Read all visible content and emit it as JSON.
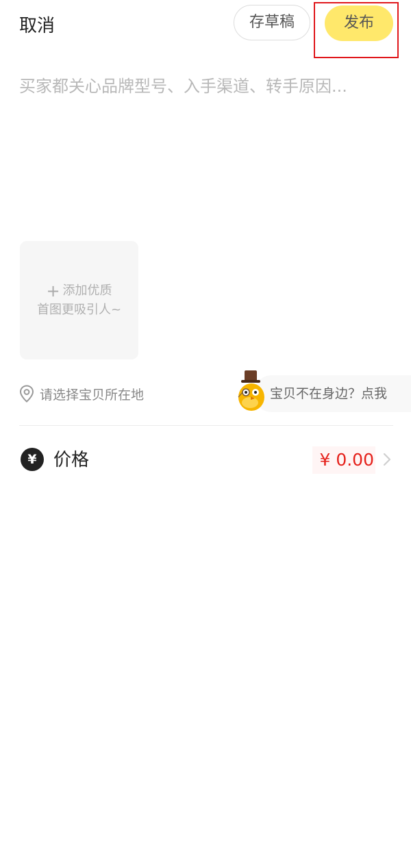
{
  "header": {
    "cancel_label": "取消",
    "draft_label": "存草稿",
    "publish_label": "发布"
  },
  "description": {
    "placeholder": "买家都关心品牌型号、入手渠道、转手原因..."
  },
  "photo": {
    "add_line1": "添加优质",
    "add_line2": "首图更吸引人~",
    "icon": "plus-icon"
  },
  "location": {
    "icon": "location-pin-icon",
    "label": "请选择宝贝所在地",
    "not_nearby_label": "宝贝不在身边？点我"
  },
  "price": {
    "icon_glyph": "¥",
    "label": "价格",
    "value": "¥ 0.00"
  },
  "colors": {
    "publish_button": "#ffe86b",
    "price_value": "#e5211b",
    "highlight_box": "#e0171b"
  }
}
